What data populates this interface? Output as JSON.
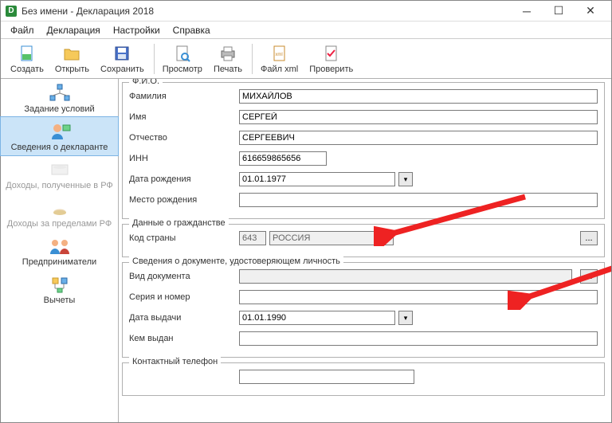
{
  "window": {
    "title": "Без имени - Декларация 2018"
  },
  "menu": {
    "file": "Файл",
    "declaration": "Декларация",
    "settings": "Настройки",
    "help": "Справка"
  },
  "toolbar": {
    "create": "Создать",
    "open": "Открыть",
    "save": "Сохранить",
    "preview": "Просмотр",
    "print": "Печать",
    "xml": "Файл xml",
    "check": "Проверить"
  },
  "sidebar": {
    "conditions": "Задание условий",
    "declarant": "Сведения о декларанте",
    "income_rf": "Доходы, полученные в РФ",
    "income_foreign": "Доходы за пределами РФ",
    "entrepreneurs": "Предприниматели",
    "deductions": "Вычеты"
  },
  "sections": {
    "fio": {
      "legend": "Ф.И.О.",
      "surname_lbl": "Фамилия",
      "surname": "МИХАЙЛОВ",
      "name_lbl": "Имя",
      "name": "СЕРГЕЙ",
      "patronymic_lbl": "Отчество",
      "patronymic": "СЕРГЕЕВИЧ",
      "inn_lbl": "ИНН",
      "inn": "616659865656",
      "dob_lbl": "Дата рождения",
      "dob": "01.01.1977",
      "pob_lbl": "Место рождения",
      "pob": ""
    },
    "citizenship": {
      "legend": "Данные о гражданстве",
      "country_code_lbl": "Код страны",
      "country_code": "643",
      "country_name": "РОССИЯ"
    },
    "id_doc": {
      "legend": "Сведения о документе, удостоверяющем личность",
      "doc_type_lbl": "Вид документа",
      "doc_type": "",
      "series_lbl": "Серия и номер",
      "series": "",
      "issue_date_lbl": "Дата выдачи",
      "issue_date": "01.01.1990",
      "issued_by_lbl": "Кем выдан",
      "issued_by": ""
    },
    "phone": {
      "legend": "Контактный телефон",
      "value": ""
    }
  }
}
